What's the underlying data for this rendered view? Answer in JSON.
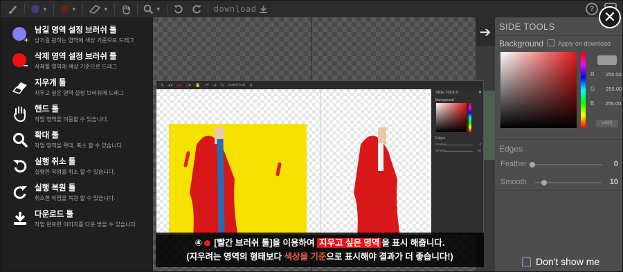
{
  "toolbar": {
    "download_label": "download",
    "help_icon_label": "?"
  },
  "help_panel": {
    "items": [
      {
        "title": "남길 영역 설정 브러쉬 툴",
        "desc": "남기길 원하는 영역에 색상 기준으로 드래그",
        "icon": "purple-brush-plus-icon"
      },
      {
        "title": "삭제 영역 설정 브러쉬 툴",
        "desc": "삭제할 영역에 색상 기준으로 드래그",
        "icon": "red-brush-minus-icon"
      },
      {
        "title": "지우개 툴",
        "desc": "지우고 싶은 영역 설정 브러쉬에 드래그",
        "icon": "eraser-icon"
      },
      {
        "title": "핸드 툴",
        "desc": "작업 영역을 이동할 수 있습니다.",
        "icon": "hand-icon"
      },
      {
        "title": "확대 툴",
        "desc": "작업 영역을 확대, 축소 할 수 있습니다.",
        "icon": "zoom-icon"
      },
      {
        "title": "실행 취소 툴",
        "desc": "실행한 작업을 취소 할 수 있습니다.",
        "icon": "undo-icon"
      },
      {
        "title": "실행 복원 툴",
        "desc": "취소한 작업을 복원 할 수 있습니다.",
        "icon": "redo-icon"
      },
      {
        "title": "다운로드 툴",
        "desc": "작업 완료한 이미지를 다운 받을 수 있습니다.",
        "icon": "download-icon"
      }
    ]
  },
  "side_tools": {
    "title": "SIDE TOOLS",
    "background_label": "Background",
    "apply_label": "Apply on download",
    "rgb": {
      "r_label": "R",
      "r": "255.00",
      "g_label": "G",
      "g": "255.00",
      "b_label": "B",
      "b": "255.00"
    },
    "hex": "#ffffff",
    "edges_label": "Edges",
    "feather_label": "Feather",
    "feather_value": "0",
    "feather_level": 0,
    "smooth_label": "Smooth",
    "smooth_value": "10",
    "smooth_level": 0.1
  },
  "close_label": "✕",
  "dont_show_label": "Don't show me",
  "inner": {
    "download_label": "download",
    "side_title": "SIDE TOOLS",
    "close_label": "✕",
    "background_label": "Background",
    "edges_label": "Edges",
    "feather_label": "Feather",
    "feather_value": "0",
    "smooth_label": "Smooth",
    "smooth_value": "10"
  },
  "caption": {
    "step": "④",
    "line1_a": "[빨간 브러쉬 툴]을 이용하여",
    "line1_hl": "지우고 싶은 영역",
    "line1_b": "을 표시 해줍니다.",
    "line2_a": "(지우려는 영역의 형태보다",
    "line2_hl": "색상을 기준",
    "line2_b": "으로 표시해야 결과가 더 좋습니다!)"
  },
  "colors": {
    "accent_purple": "#7f7ff0",
    "accent_red": "#e8141a",
    "canvas_yellow": "#f5e200"
  }
}
